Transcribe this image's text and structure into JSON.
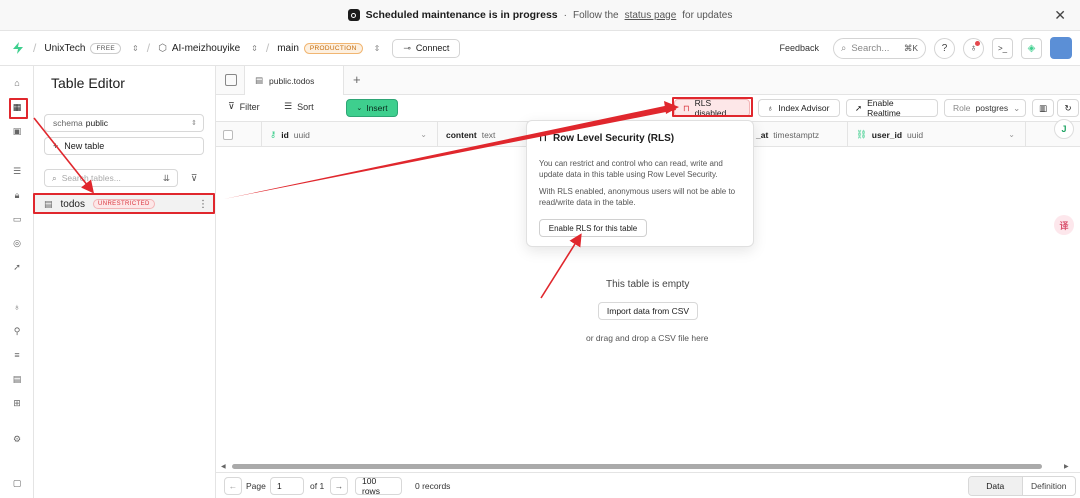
{
  "banner": {
    "title": "Scheduled maintenance is in progress",
    "separator": "·",
    "text_before": "Follow the",
    "link": "status page",
    "text_after": "for updates"
  },
  "topbar": {
    "org": "UnixTech",
    "org_plan": "FREE",
    "project": "AI-meizhouyike",
    "branch": "main",
    "branch_env": "PRODUCTION",
    "connect": "Connect",
    "feedback": "Feedback",
    "search_placeholder": "Search...",
    "search_shortcut": "⌘K"
  },
  "sidebar": {
    "title": "Table Editor",
    "schema_label": "schema",
    "schema_value": "public",
    "new_table": "New table",
    "search_placeholder": "Search tables...",
    "table_name": "todos",
    "table_badge": "UNRESTRICTED"
  },
  "tabs": {
    "active": "public.todos"
  },
  "toolbar": {
    "filter": "Filter",
    "sort": "Sort",
    "insert": "Insert",
    "rls": "RLS disabled",
    "index_advisor": "Index Advisor",
    "realtime": "Enable Realtime",
    "role_label": "Role",
    "role_value": "postgres"
  },
  "columns": [
    {
      "name": "id",
      "type": "uuid"
    },
    {
      "name": "content",
      "type": "text"
    },
    {
      "name": "_at",
      "type": "timestamptz"
    },
    {
      "name": "user_id",
      "type": "uuid"
    }
  ],
  "popover": {
    "title": "Row Level Security (RLS)",
    "p1": "You can restrict and control who can read, write and update data in this table using Row Level Security.",
    "p2": "With RLS enabled, anonymous users will not be able to read/write data in the table.",
    "button": "Enable RLS for this table"
  },
  "empty": {
    "title": "This table is empty",
    "import": "Import data from CSV",
    "sub": "or drag and drop a CSV file here"
  },
  "footer": {
    "page_label": "Page",
    "page_value": "1",
    "of": "of 1",
    "rows": "100 rows",
    "records": "0 records",
    "data_tab": "Data",
    "definition_tab": "Definition"
  },
  "fabs": {
    "green": "J",
    "pink": "译"
  },
  "colors": {
    "accent": "#3ecf8e",
    "annotation_red": "#e0272d"
  }
}
